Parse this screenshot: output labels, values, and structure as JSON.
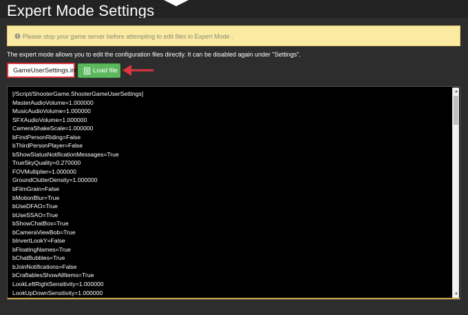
{
  "page": {
    "title": "Expert Mode Settings"
  },
  "alert": {
    "icon": "exclamation-circle-icon",
    "text": "Please stop your game server before attempting to edit files in Expert Mode ."
  },
  "description": "The expert mode allows you to edit the configuration files directly. It can be disabled again under \"Settings\".",
  "file_select": {
    "value": "GameUserSettings.ini"
  },
  "load_button": {
    "label": "Load file",
    "icon": "file-icon"
  },
  "editor": {
    "lines": [
      "[/Script/ShooterGame.ShooterGameUserSettings]",
      "MasterAudioVolume=1.000000",
      "MusicAudioVolume=1.000000",
      "SFXAudioVolume=1.000000",
      "CameraShakeScale=1.000000",
      "bFirstPersonRiding=False",
      "bThirdPersonPlayer=False",
      "bShowStatusNotificationMessages=True",
      "TrueSkyQuality=0.270000",
      "FOVMultiplier=1.000000",
      "GroundClutterDensity=1.000000",
      "bFilmGrain=False",
      "bMotionBlur=True",
      "bUseDFAO=True",
      "bUseSSAO=True",
      "bShowChatBox=True",
      "bCameraViewBob=True",
      "bInvertLookY=False",
      "bFloatingNames=True",
      "bChatBubbles=True",
      "bJoinNotifications=False",
      "bCraftablesShowAllItems=True",
      "LookLeftRightSensitivity=1.000000",
      "LookUpDownSensitivity=1.000000"
    ]
  },
  "colors": {
    "accent": "#5cb85c",
    "highlight": "#e0353e",
    "alert_bg": "#fbeaa1",
    "gold": "#c8a24a"
  }
}
